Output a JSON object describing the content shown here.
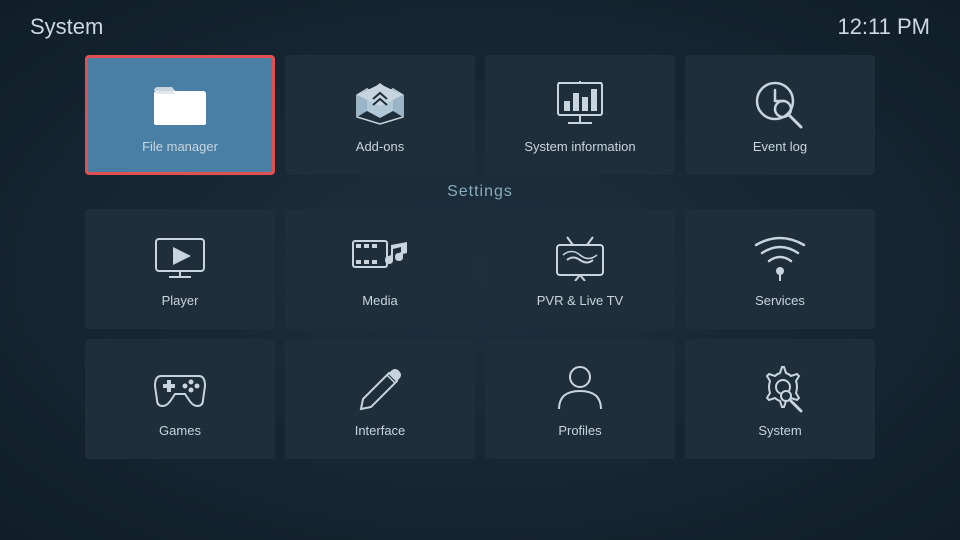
{
  "header": {
    "title": "System",
    "time": "12:11 PM"
  },
  "top_tiles": [
    {
      "id": "file-manager",
      "label": "File manager",
      "selected": true
    },
    {
      "id": "add-ons",
      "label": "Add-ons",
      "selected": false
    },
    {
      "id": "system-information",
      "label": "System information",
      "selected": false
    },
    {
      "id": "event-log",
      "label": "Event log",
      "selected": false
    }
  ],
  "settings_label": "Settings",
  "settings_tiles_row1": [
    {
      "id": "player",
      "label": "Player"
    },
    {
      "id": "media",
      "label": "Media"
    },
    {
      "id": "pvr-live-tv",
      "label": "PVR & Live TV"
    },
    {
      "id": "services",
      "label": "Services"
    }
  ],
  "settings_tiles_row2": [
    {
      "id": "games",
      "label": "Games"
    },
    {
      "id": "interface",
      "label": "Interface"
    },
    {
      "id": "profiles",
      "label": "Profiles"
    },
    {
      "id": "system",
      "label": "System"
    }
  ]
}
